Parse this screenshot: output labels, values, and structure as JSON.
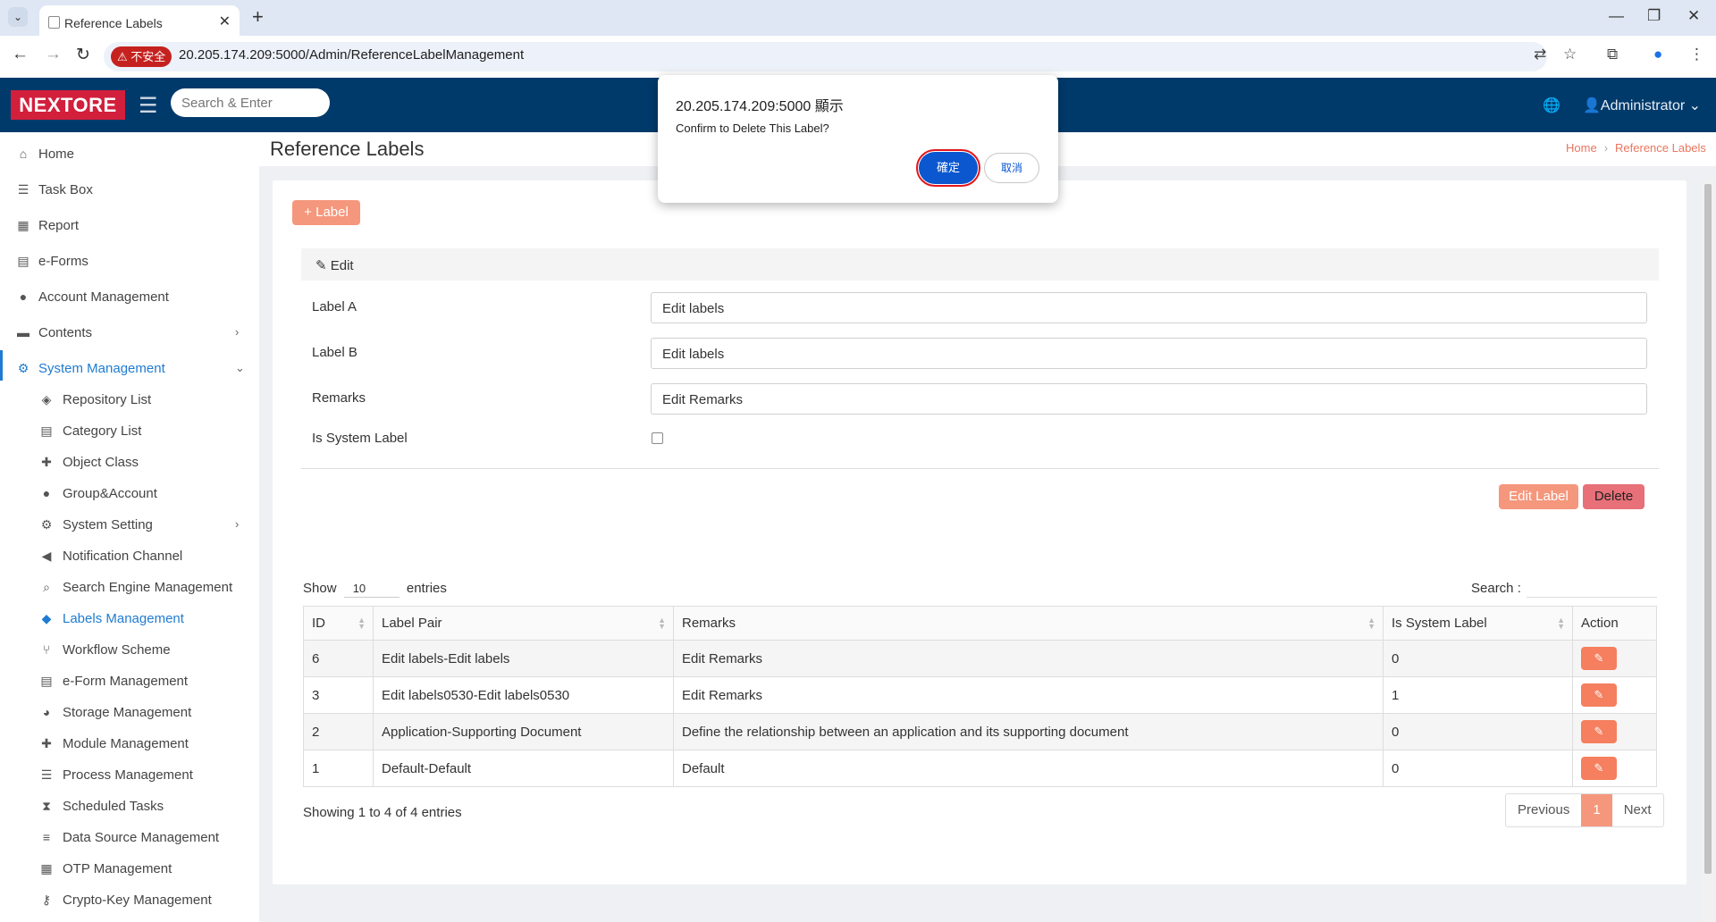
{
  "browser": {
    "tab_title": "Reference Labels",
    "security_label": "不安全",
    "url": "20.205.174.209:5000/Admin/ReferenceLabelManagement"
  },
  "header": {
    "logo": "NEXTORE",
    "search_placeholder": "Search & Enter",
    "user": "Administrator"
  },
  "sidebar": {
    "items": [
      {
        "label": "Home",
        "icon": "home-icon"
      },
      {
        "label": "Task Box",
        "icon": "tasks-icon"
      },
      {
        "label": "Report",
        "icon": "table-icon"
      },
      {
        "label": "e-Forms",
        "icon": "form-icon"
      },
      {
        "label": "Account Management",
        "icon": "user-icon"
      },
      {
        "label": "Contents",
        "icon": "folder-icon"
      },
      {
        "label": "System Management",
        "icon": "gears-icon"
      }
    ],
    "sub_items": [
      {
        "label": "Repository List"
      },
      {
        "label": "Category List"
      },
      {
        "label": "Object Class"
      },
      {
        "label": "Group&Account"
      },
      {
        "label": "System Setting"
      },
      {
        "label": "Notification Channel"
      },
      {
        "label": "Search Engine Management"
      },
      {
        "label": "Labels Management"
      },
      {
        "label": "Workflow Scheme"
      },
      {
        "label": "e-Form Management"
      },
      {
        "label": "Storage Management"
      },
      {
        "label": "Module Management"
      },
      {
        "label": "Process Management"
      },
      {
        "label": "Scheduled Tasks"
      },
      {
        "label": "Data Source Management"
      },
      {
        "label": "OTP Management"
      },
      {
        "label": "Crypto-Key Management"
      }
    ]
  },
  "page": {
    "title": "Reference Labels",
    "breadcrumb_home": "Home",
    "breadcrumb_current": "Reference Labels",
    "add_label_button": "Label",
    "edit_section_title": "Edit",
    "form": {
      "label_a": "Label A",
      "label_a_value": "Edit labels",
      "label_b": "Label B",
      "label_b_value": "Edit labels",
      "remarks": "Remarks",
      "remarks_value": "Edit Remarks",
      "is_system_label": "Is System Label"
    },
    "edit_button": "Edit Label",
    "delete_button": "Delete"
  },
  "table": {
    "show": "Show",
    "entries_value": "10",
    "entries": "entries",
    "search_label": "Search :",
    "columns": [
      "ID",
      "Label Pair",
      "Remarks",
      "Is System Label",
      "Action"
    ],
    "rows": [
      {
        "id": "6",
        "pair": "Edit labels-Edit labels",
        "remarks": "Edit Remarks",
        "system": "0"
      },
      {
        "id": "3",
        "pair": "Edit labels0530-Edit labels0530",
        "remarks": "Edit Remarks",
        "system": "1"
      },
      {
        "id": "2",
        "pair": "Application-Supporting Document",
        "remarks": "Define the relationship between an application and its supporting document",
        "system": "0"
      },
      {
        "id": "1",
        "pair": "Default-Default",
        "remarks": "Default",
        "system": "0"
      }
    ],
    "showing": "Showing 1 to 4 of 4 entries",
    "prev": "Previous",
    "page": "1",
    "next": "Next"
  },
  "dialog": {
    "title": "20.205.174.209:5000 顯示",
    "message": "Confirm to Delete This Label?",
    "ok": "確定",
    "cancel": "取消"
  }
}
